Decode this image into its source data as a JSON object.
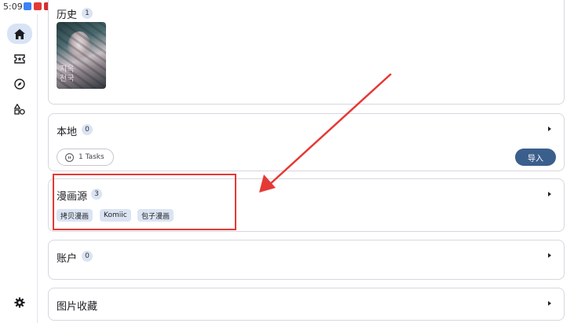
{
  "status_bar": {
    "time": "5:09",
    "notification_colors": [
      "#3b82f6",
      "#e53935",
      "#d32f2f",
      "#64b5f6",
      "#1e88e5"
    ]
  },
  "rail": {
    "items": [
      {
        "icon": "home-icon",
        "active": true
      },
      {
        "icon": "ticket-icon",
        "active": false
      },
      {
        "icon": "compass-icon",
        "active": false
      },
      {
        "icon": "shapes-icon",
        "active": false
      }
    ],
    "settings_icon": "gear-icon"
  },
  "history": {
    "title": "历史",
    "count": "1",
    "cover_text": "지옥\n천국"
  },
  "local": {
    "title": "本地",
    "count": "0",
    "tasks_label": "1 Tasks",
    "import_label": "导入"
  },
  "sources": {
    "title": "漫画源",
    "count": "3",
    "chips": [
      "拷贝漫画",
      "Komiic",
      "包子漫画"
    ]
  },
  "account": {
    "title": "账户",
    "count": "0"
  },
  "favorites": {
    "title": "图片收藏"
  },
  "annotation": {
    "color": "#e53935"
  }
}
